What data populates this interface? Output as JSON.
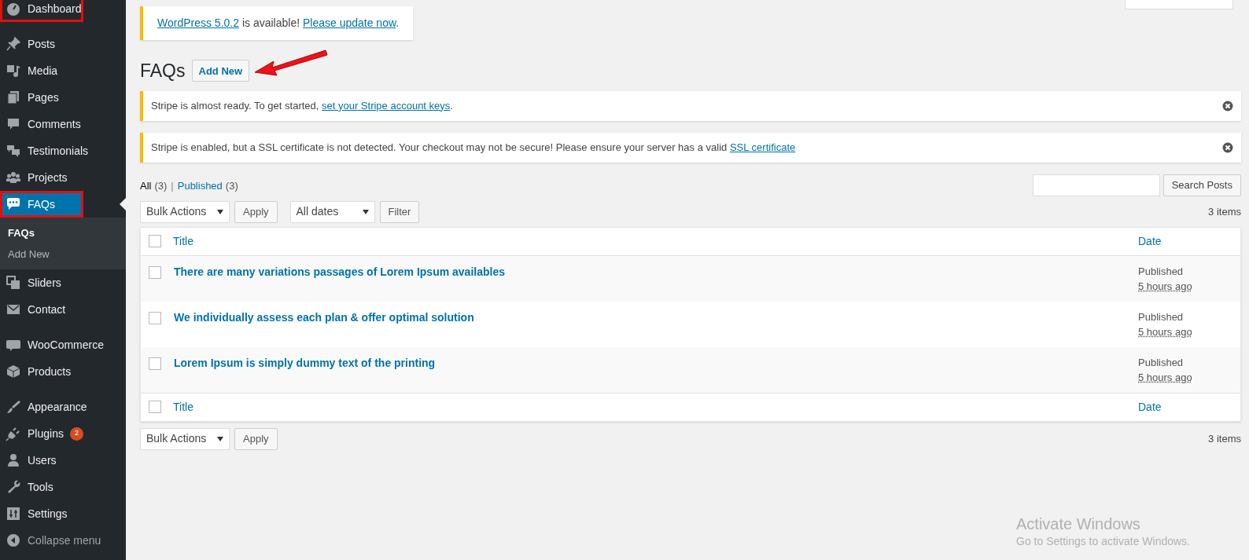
{
  "sidebar": {
    "groups": [
      {
        "items": [
          {
            "label": "Dashboard",
            "selected": false,
            "highlighted": true
          }
        ]
      },
      {
        "items": [
          {
            "label": "Posts",
            "selected": false,
            "highlighted": false
          },
          {
            "label": "Media",
            "selected": false,
            "highlighted": false
          },
          {
            "label": "Pages",
            "selected": false,
            "highlighted": false
          },
          {
            "label": "Comments",
            "selected": false,
            "highlighted": false
          },
          {
            "label": "Testimonials",
            "selected": false,
            "highlighted": false
          },
          {
            "label": "Projects",
            "selected": false,
            "highlighted": false
          },
          {
            "label": "FAQs",
            "selected": true,
            "highlighted": true,
            "children": [
              {
                "label": "FAQs",
                "selected": true
              },
              {
                "label": "Add New",
                "selected": false
              }
            ]
          },
          {
            "label": "Sliders",
            "selected": false,
            "highlighted": false
          },
          {
            "label": "Contact",
            "selected": false,
            "highlighted": false
          }
        ]
      },
      {
        "items": [
          {
            "label": "WooCommerce",
            "selected": false,
            "highlighted": false
          },
          {
            "label": "Products",
            "selected": false,
            "highlighted": false
          }
        ]
      },
      {
        "items": [
          {
            "label": "Appearance",
            "selected": false,
            "highlighted": false
          },
          {
            "label": "Plugins",
            "selected": false,
            "highlighted": false,
            "badge": "2"
          },
          {
            "label": "Users",
            "selected": false,
            "highlighted": false
          },
          {
            "label": "Tools",
            "selected": false,
            "highlighted": false
          },
          {
            "label": "Settings",
            "selected": false,
            "highlighted": false
          },
          {
            "label": "Collapse menu",
            "selected": false,
            "highlighted": false
          }
        ]
      }
    ]
  },
  "update_notice": {
    "link": "WordPress 5.0.2",
    "text": " is available! ",
    "action": "Please update now",
    "end": "."
  },
  "heading": {
    "title": "FAQs",
    "button": "Add New"
  },
  "notices": [
    {
      "text": "Stripe is almost ready. To get started, ",
      "link": "set your Stripe account keys",
      "end": "."
    },
    {
      "text": "Stripe is enabled, but a SSL certificate is not detected. Your checkout may not be secure! Please ensure your server has a valid ",
      "link": "SSL certificate"
    }
  ],
  "views": [
    {
      "label": "All",
      "count": "(3)",
      "selected": true
    },
    {
      "label": "Published",
      "count": "(3)",
      "selected": false,
      "separator": "|"
    }
  ],
  "search": {
    "button": "Search Posts"
  },
  "top_toolbar": {
    "bulk": "Bulk Actions",
    "apply": "Apply",
    "dates": "All dates",
    "filter": "Filter",
    "count": "3 items"
  },
  "table": {
    "columns": [
      "Title",
      "Date"
    ],
    "header_checked": false,
    "footer_checked": false,
    "rows": [
      {
        "title": "There are many variations passages of Lorem Ipsum availables",
        "status": "Published",
        "date": "5 hours ago",
        "checked": false
      },
      {
        "title": "We individually assess each plan & offer optimal solution",
        "status": "Published",
        "date": "5 hours ago",
        "checked": false
      },
      {
        "title": "Lorem Ipsum is simply dummy text of the printing",
        "status": "Published",
        "date": "5 hours ago",
        "checked": false
      }
    ],
    "footer_columns": [
      "Title",
      "Date"
    ]
  },
  "bottom_toolbar": {
    "bulk": "Bulk Actions",
    "apply": "Apply",
    "count": "3 items"
  },
  "os_overlay": {
    "title": "Activate Windows",
    "subtitle": "Go to Settings to activate Windows."
  }
}
